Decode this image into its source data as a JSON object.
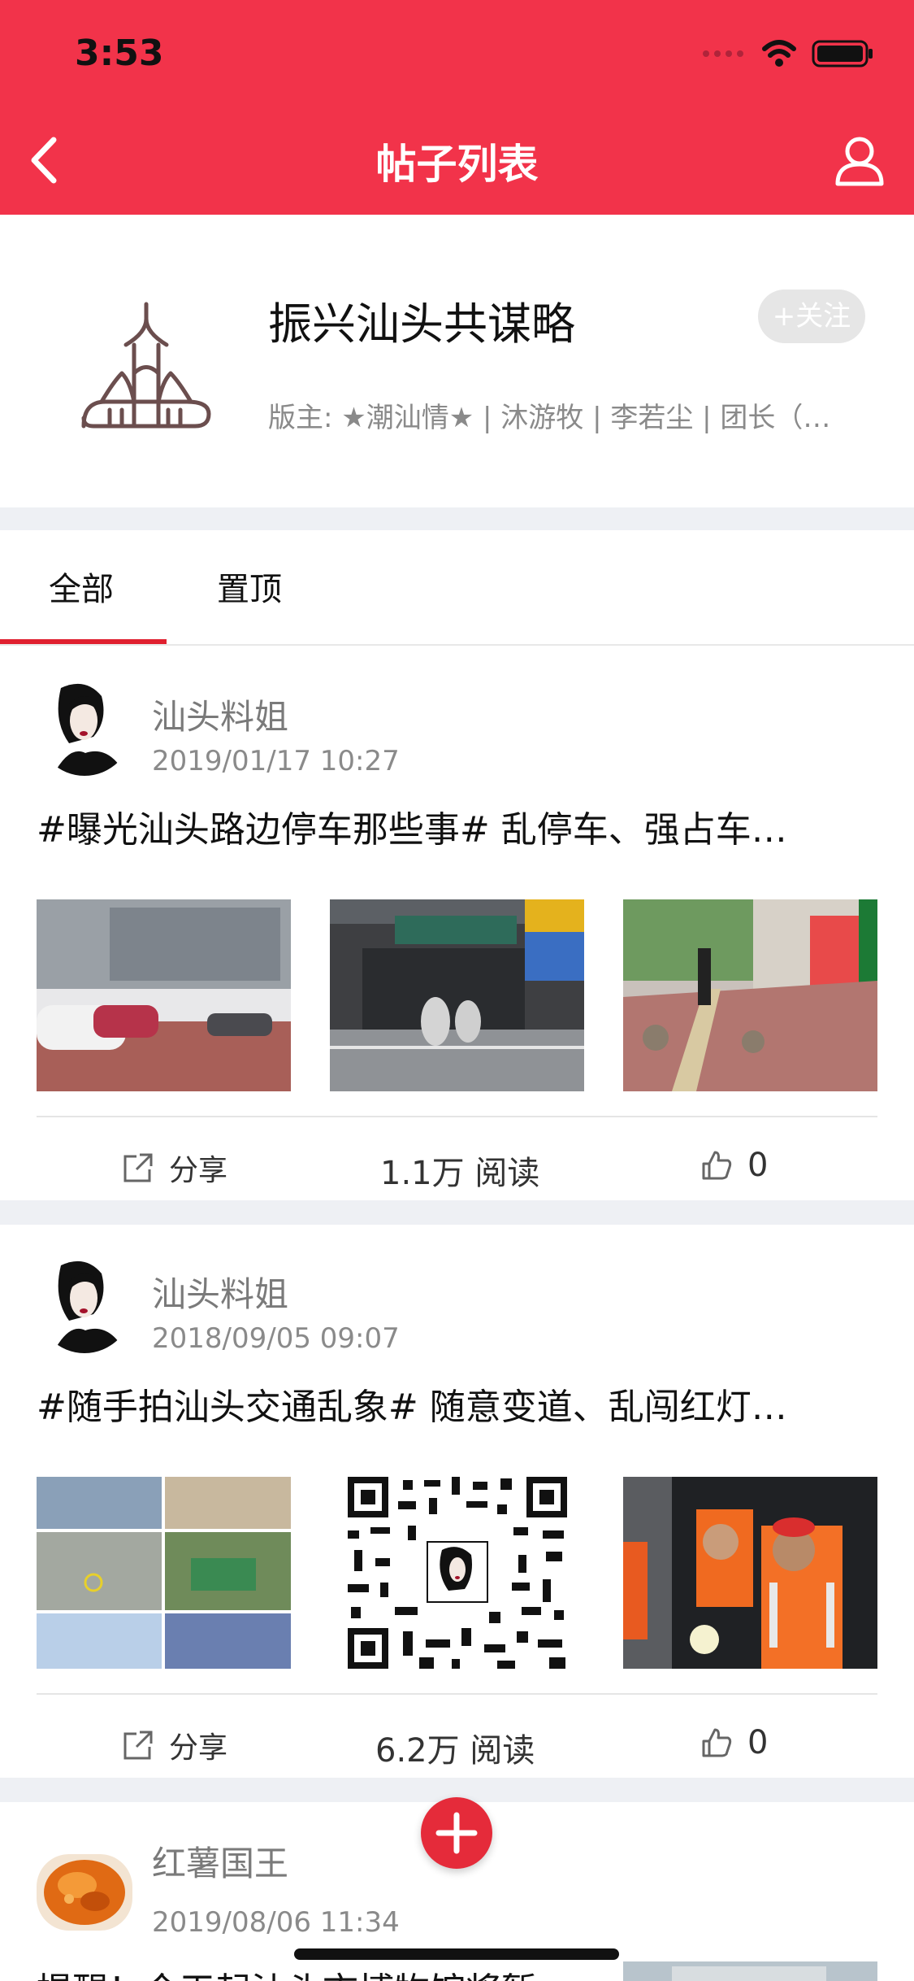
{
  "status": {
    "time": "3:53"
  },
  "nav": {
    "title": "帖子列表"
  },
  "forum": {
    "name": "振兴汕头共谋略",
    "follow_label": "+关注",
    "moderators": "版主: ★潮汕情★ | 沐游牧 | 李若尘 | 团长（…"
  },
  "tabs": [
    {
      "label": "全部"
    },
    {
      "label": "置顶"
    }
  ],
  "colors": {
    "brand": "#f2334a",
    "tab_active": "#e0202f",
    "fab": "#e52b3a"
  },
  "posts": [
    {
      "author": "汕头料姐",
      "date": "2019/01/17 10:27",
      "title": "#曝光汕头路边停车那些事# 乱停车、强占车…",
      "share_label": "分享",
      "reads": "1.1万 阅读",
      "likes": "0"
    },
    {
      "author": "汕头料姐",
      "date": "2018/09/05 09:07",
      "title": "#随手拍汕头交通乱象# 随意变道、乱闯红灯…",
      "share_label": "分享",
      "reads": "6.2万 阅读",
      "likes": "0"
    },
    {
      "author": "红薯国王",
      "date": "2019/08/06 11:34",
      "title": "提醒！今天起汕头市博物馆将暂…"
    }
  ],
  "icons": {
    "back": "chevron-left-icon",
    "user": "user-icon",
    "share": "share-icon",
    "like": "thumbs-up-icon",
    "add": "plus-icon"
  }
}
